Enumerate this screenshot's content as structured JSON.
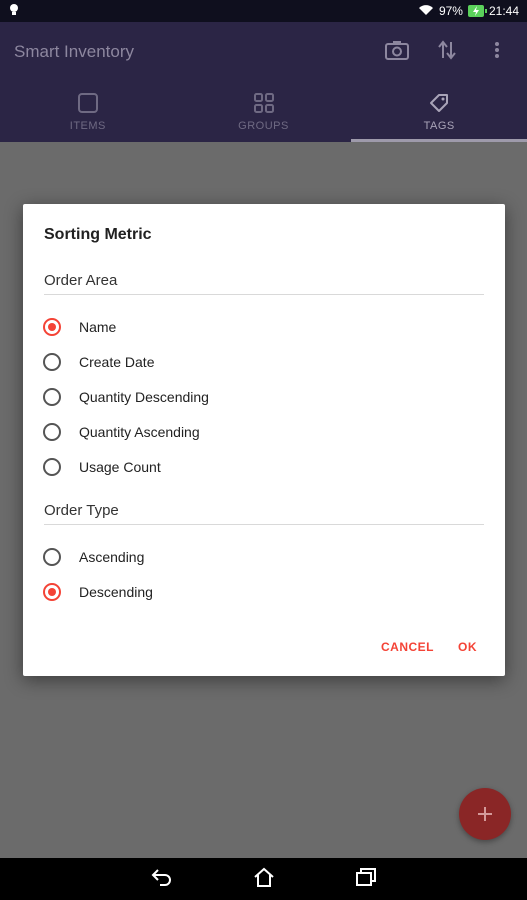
{
  "status_bar": {
    "battery_percent": "97%",
    "time": "21:44"
  },
  "app_bar": {
    "title": "Smart Inventory",
    "tabs": [
      {
        "label": "ITEMS",
        "icon": "square-icon"
      },
      {
        "label": "GROUPS",
        "icon": "grid-icon"
      },
      {
        "label": "TAGS",
        "icon": "tag-icon",
        "active": true
      }
    ]
  },
  "dialog": {
    "title": "Sorting Metric",
    "order_area": {
      "label": "Order Area",
      "options": [
        {
          "label": "Name",
          "checked": true
        },
        {
          "label": "Create Date",
          "checked": false
        },
        {
          "label": "Quantity Descending",
          "checked": false
        },
        {
          "label": "Quantity Ascending",
          "checked": false
        },
        {
          "label": "Usage Count",
          "checked": false
        }
      ]
    },
    "order_type": {
      "label": "Order Type",
      "options": [
        {
          "label": "Ascending",
          "checked": false
        },
        {
          "label": "Descending",
          "checked": true
        }
      ]
    },
    "cancel_label": "CANCEL",
    "ok_label": "OK"
  },
  "colors": {
    "accent": "#f44336",
    "app_bar": "#2b2545",
    "scrim": "#6b6b6b"
  }
}
